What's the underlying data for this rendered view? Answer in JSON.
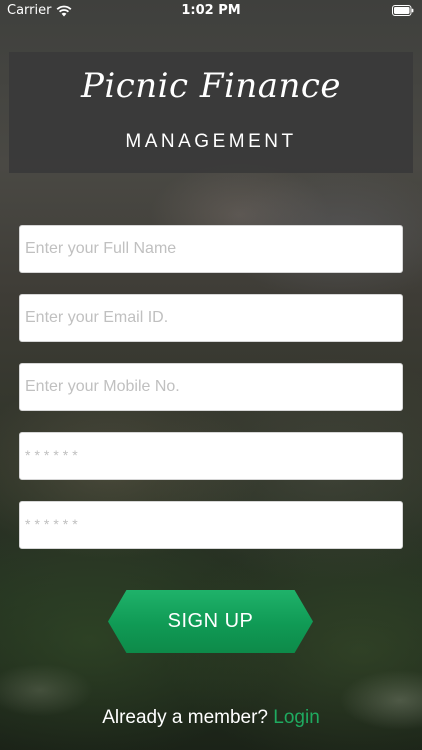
{
  "status_bar": {
    "carrier": "Carrier",
    "time": "1:02 PM"
  },
  "header": {
    "title_script": "Picnic Finance",
    "title_sub": "MANAGEMENT"
  },
  "form": {
    "full_name_placeholder": "Enter your Full Name",
    "email_placeholder": "Enter your Email ID.",
    "mobile_placeholder": "Enter your Mobile No.",
    "password_placeholder": "******",
    "confirm_password_placeholder": "******"
  },
  "signup_label": "SIGN UP",
  "footer": {
    "prompt": "Already a member?",
    "login_label": "Login"
  },
  "colors": {
    "accent_green": "#109a55",
    "link_green": "#1faa60",
    "header_bg": "#3a3a3a"
  },
  "icons": [
    "wifi-icon",
    "battery-icon"
  ]
}
